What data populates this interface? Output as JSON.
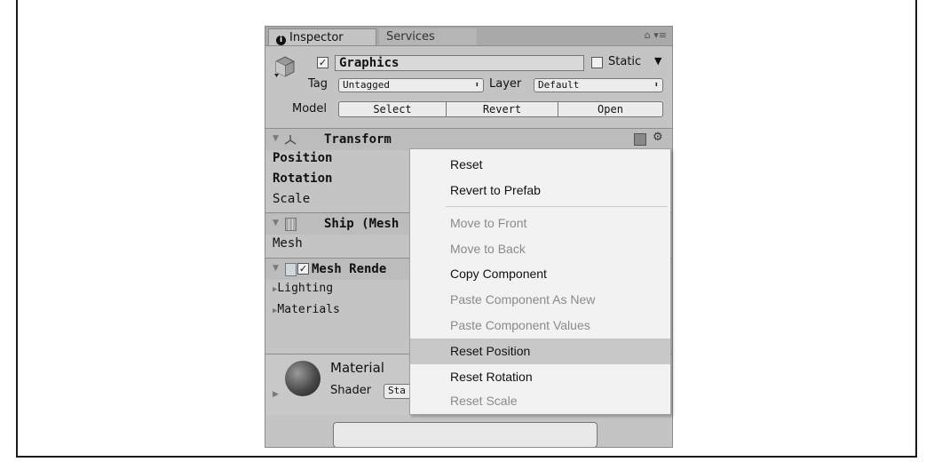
{
  "tabs": {
    "inspector": "Inspector",
    "services": "Services",
    "tools": "⌂ ▾≡"
  },
  "object": {
    "name": "Graphics",
    "static_label": "Static",
    "tag_label": "Tag",
    "tag_value": "Untagged",
    "layer_label": "Layer",
    "layer_value": "Default",
    "model_label": "Model",
    "model_buttons": {
      "select": "Select",
      "revert": "Revert",
      "open": "Open"
    }
  },
  "transform": {
    "title": "Transform",
    "position": "Position",
    "rotation": "Rotation",
    "scale": "Scale"
  },
  "mesh_filter": {
    "title": "Ship (Mesh",
    "mesh": "Mesh"
  },
  "mesh_renderer": {
    "title": "Mesh Rende",
    "lighting": "Lighting",
    "materials": "Materials"
  },
  "material": {
    "name": "Material",
    "shader_label": "Shader",
    "shader_value": "Sta"
  },
  "context_menu": {
    "reset": "Reset",
    "revert_to_prefab": "Revert to Prefab",
    "move_to_front": "Move to Front",
    "move_to_back": "Move to Back",
    "copy_component": "Copy Component",
    "paste_component_as_new": "Paste Component As New",
    "paste_component_values": "Paste Component Values",
    "reset_position": "Reset Position",
    "reset_rotation": "Reset Rotation",
    "reset_scale": "Reset Scale"
  },
  "colors": {
    "panel": "#c4c4c4",
    "menu_bg": "#f2f2f2",
    "menu_highlight": "#c8c8c8"
  }
}
